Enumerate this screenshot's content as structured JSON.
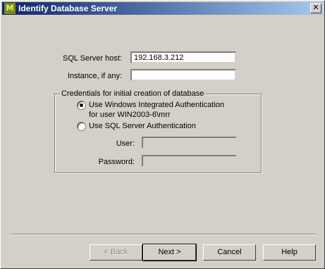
{
  "window": {
    "title": "Identify Database Server",
    "icon": "M",
    "close_glyph": "✕"
  },
  "server": {
    "host_label": "SQL Server host:",
    "host_value": "192.168.3.212",
    "instance_label": "Instance, if any:",
    "instance_value": ""
  },
  "credentials": {
    "group_label": "Credentials for initial creation of database",
    "windows_auth_line1": "Use Windows Integrated Authentication",
    "windows_auth_line2": "for user WIN2003-6\\mrr",
    "sql_auth_label": "Use SQL Server Authentication",
    "selected": "windows",
    "user_label": "User:",
    "user_value": "",
    "password_label": "Password:",
    "password_value": ""
  },
  "buttons": {
    "back": "< Back",
    "next": "Next >",
    "cancel": "Cancel",
    "help": "Help"
  }
}
